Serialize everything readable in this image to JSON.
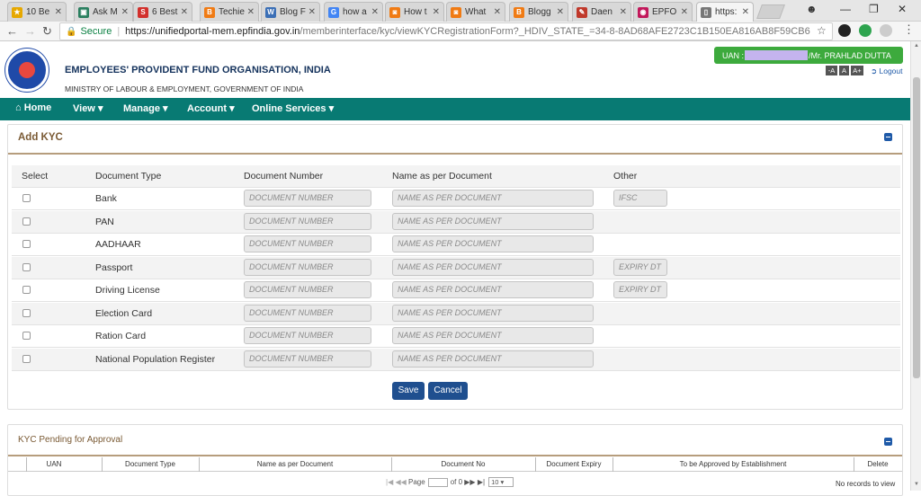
{
  "browser": {
    "tabs": [
      {
        "label": "10 Be",
        "color": "#e6a800",
        "glyph": "★"
      },
      {
        "label": "Ask M",
        "color": "#2a7f5f",
        "glyph": "▣"
      },
      {
        "label": "6 Best",
        "color": "#d2302c",
        "glyph": "S"
      },
      {
        "label": "Techie",
        "color": "#f07b14",
        "glyph": "B"
      },
      {
        "label": "Blog F",
        "color": "#3b6fb6",
        "glyph": "W"
      },
      {
        "label": "how a",
        "color": "#4285f4",
        "glyph": "G"
      },
      {
        "label": "How t",
        "color": "#f07b14",
        "glyph": "◙"
      },
      {
        "label": "What",
        "color": "#f07b14",
        "glyph": "◙"
      },
      {
        "label": "Blogg",
        "color": "#f07b14",
        "glyph": "B"
      },
      {
        "label": "Daen",
        "color": "#c0392b",
        "glyph": "✎"
      },
      {
        "label": "EPFO",
        "color": "#c2185b",
        "glyph": "◉"
      },
      {
        "label": "https:",
        "color": "#777777",
        "glyph": "▯"
      }
    ],
    "secure_label": "Secure",
    "url_host": "https://unifiedportal-mem.epfindia.gov.in",
    "url_path": "/memberinterface/kyc/viewKYCRegistrationForm?_HDIV_STATE_=34-8-8AD68AFE2723C1B150EA816AB8F59CB6"
  },
  "header": {
    "org_name": "EMPLOYEES' PROVIDENT FUND ORGANISATION, INDIA",
    "ministry": "MINISTRY OF LABOUR & EMPLOYMENT, GOVERNMENT OF INDIA",
    "uan_prefix": "UAN :",
    "uan_user": "/Mr. PRAHLAD DUTTA",
    "font_small": "-A",
    "font_normal": "A",
    "font_large": "A+",
    "logout": "Logout"
  },
  "menu": {
    "home": "Home",
    "view": "View",
    "manage": "Manage",
    "account": "Account",
    "online_services": "Online Services"
  },
  "add_kyc": {
    "title": "Add KYC",
    "columns": {
      "select": "Select",
      "doc_type": "Document Type",
      "doc_number": "Document Number",
      "name": "Name as per Document",
      "other": "Other"
    },
    "rows": [
      {
        "type": "Bank",
        "number_ph": "DOCUMENT NUMBER",
        "name_ph": "NAME AS PER DOCUMENT",
        "other_ph": "IFSC"
      },
      {
        "type": "PAN",
        "number_ph": "DOCUMENT NUMBER",
        "name_ph": "NAME AS PER DOCUMENT",
        "other_ph": ""
      },
      {
        "type": "AADHAAR",
        "number_ph": "DOCUMENT NUMBER",
        "name_ph": "NAME AS PER DOCUMENT",
        "other_ph": ""
      },
      {
        "type": "Passport",
        "number_ph": "DOCUMENT NUMBER",
        "name_ph": "NAME AS PER DOCUMENT",
        "other_ph": "EXPIRY DT"
      },
      {
        "type": "Driving License",
        "number_ph": "DOCUMENT NUMBER",
        "name_ph": "NAME AS PER DOCUMENT",
        "other_ph": "EXPIRY DT"
      },
      {
        "type": "Election Card",
        "number_ph": "DOCUMENT NUMBER",
        "name_ph": "NAME AS PER DOCUMENT",
        "other_ph": ""
      },
      {
        "type": "Ration Card",
        "number_ph": "DOCUMENT NUMBER",
        "name_ph": "NAME AS PER DOCUMENT",
        "other_ph": ""
      },
      {
        "type": "National Population Register",
        "number_ph": "DOCUMENT NUMBER",
        "name_ph": "NAME AS PER DOCUMENT",
        "other_ph": ""
      }
    ],
    "save": "Save",
    "cancel": "Cancel"
  },
  "pending": {
    "title": "KYC Pending for Approval",
    "columns": [
      "UAN",
      "Document Type",
      "Name as per Document",
      "Document No",
      "Document Expiry",
      "To be Approved by Establishment",
      "Delete"
    ],
    "pager_page": "Page",
    "pager_of": "of 0",
    "page_size": "10",
    "no_records": "No records to view"
  },
  "colors": {
    "menu_bg": "#087a73",
    "uan_bg": "#3daa3d",
    "title_color": "#7a5a34",
    "button_bg": "#1f4f8f"
  }
}
